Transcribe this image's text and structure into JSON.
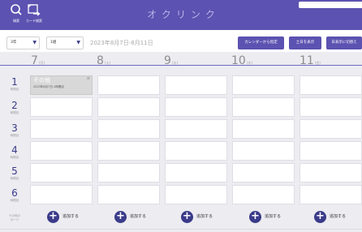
{
  "header": {
    "title": "オクリンク",
    "search_label": "検索",
    "card_list_label": "カード検索"
  },
  "toolbar": {
    "class_select": "3年",
    "group_select": "1組",
    "date_range": "2023年8月7日-8月11日",
    "btn_calendar": "カレンダーから指定",
    "btn_show_weekend": "土日を表示",
    "btn_switch_daily": "日表示に切替え"
  },
  "days": [
    {
      "num": "7",
      "weekday": "(月)"
    },
    {
      "num": "8",
      "weekday": "(火)"
    },
    {
      "num": "9",
      "weekday": "(水)"
    },
    {
      "num": "10",
      "weekday": "(木)"
    },
    {
      "num": "11",
      "weekday": "(金)"
    }
  ],
  "periods": [
    {
      "num": "1",
      "label": "時間目"
    },
    {
      "num": "2",
      "label": "時間目"
    },
    {
      "num": "3",
      "label": "時間目"
    },
    {
      "num": "4",
      "label": "時間目"
    },
    {
      "num": "5",
      "label": "時間目"
    },
    {
      "num": "6",
      "label": "時間目"
    }
  ],
  "lesson": {
    "title": "その他",
    "date": "2023年8月7日-1時間目",
    "menu_icon": "menu-lines-icon"
  },
  "add_row": {
    "label_line1": "その他の",
    "label_line2": "ボード",
    "add_label": "追加する"
  },
  "colors": {
    "header": "#5c52b1",
    "primary_button": "#5c52b1",
    "accent_dark": "#3b3b8a",
    "grid_bg": "#ececf1",
    "filled_cell": "#d8d8d8"
  }
}
